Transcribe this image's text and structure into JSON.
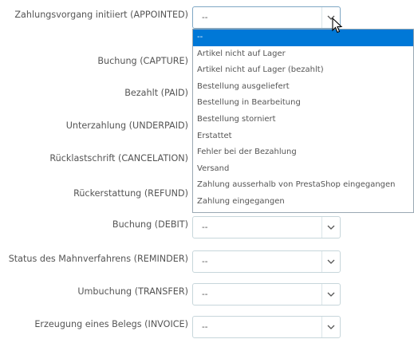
{
  "rows": [
    {
      "label": "Zahlungsvorgang initiiert (APPOINTED)",
      "value": "--"
    },
    {
      "label": "Buchung (CAPTURE)",
      "value": "--"
    },
    {
      "label": "Bezahlt (PAID)",
      "value": "--"
    },
    {
      "label": "Unterzahlung (UNDERPAID)",
      "value": "--"
    },
    {
      "label": "Rücklastschrift (CANCELATION)",
      "value": "--"
    },
    {
      "label": "Rückerstattung (REFUND)",
      "value": "--"
    },
    {
      "label": "Buchung (DEBIT)",
      "value": "--"
    },
    {
      "label": "Status des Mahnverfahrens (REMINDER)",
      "value": "--"
    },
    {
      "label": "Umbuchung (TRANSFER)",
      "value": "--"
    },
    {
      "label": "Erzeugung eines Belegs (INVOICE)",
      "value": "--"
    }
  ],
  "dropdown": {
    "options": [
      "--",
      "Artikel nicht auf Lager",
      "Artikel nicht auf Lager (bezahlt)",
      "Bestellung ausgeliefert",
      "Bestellung in Bearbeitung",
      "Bestellung storniert",
      "Erstattet",
      "Fehler bei der Bezahlung",
      "Versand",
      "Zahlung ausserhalb von PrestaShop eingegangen",
      "Zahlung eingegangen"
    ],
    "highlighted_index": 0
  },
  "colors": {
    "highlight": "#0078d7",
    "border": "#c7d6db",
    "label_text": "#555555"
  }
}
